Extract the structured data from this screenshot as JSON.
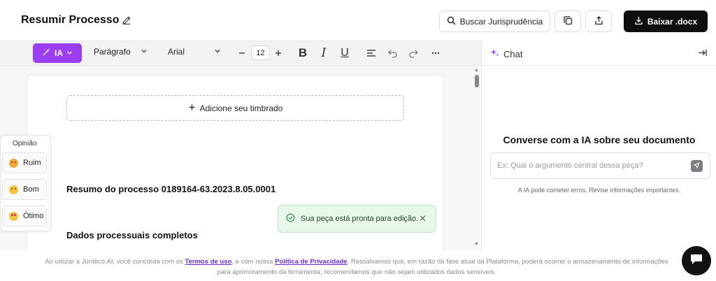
{
  "header": {
    "title": "Resumir Processo",
    "search_label": "Buscar Jurisprudência",
    "download_label": "Baixar .docx"
  },
  "toolbar": {
    "ia_label": "IA",
    "paragraph_style": "Parágrafo",
    "font_family": "Arial",
    "font_size": "12"
  },
  "document": {
    "letterhead_label": "Adicione seu timbrado",
    "heading_1": "Resumo do processo 0189164-63.2023.8.05.0001",
    "heading_2": "Dados processuais completos"
  },
  "feedback": {
    "title": "Opinião",
    "options": [
      {
        "label": "Ruim",
        "icon": "grimace-face-icon"
      },
      {
        "label": "Bom",
        "icon": "smile-face-icon"
      },
      {
        "label": "Ótimo",
        "icon": "heart-eyes-face-icon"
      }
    ]
  },
  "toast": {
    "message": "Sua peça está pronta para edição."
  },
  "chat": {
    "title": "Chat",
    "heading": "Converse com a IA sobre seu documento",
    "input_placeholder": "Ex: Qual o argumento central dessa peça?",
    "disclaimer": "A IA pode cometer erros. Revise informações importantes."
  },
  "footer": {
    "text_1": "Ao utilizar a Jurídico.AI, você concorda com os",
    "terms_link": "Termos de uso",
    "text_2": ", e com nossa",
    "privacy_link": "Política de Privacidade",
    "text_3": ". Ressalvamos que, em razão da fase atual da Plataforma, poderá ocorrer o armazenamento de informações para aprimoramento da ferramenta; recomendamos que não sejam utilizados dados sensíveis."
  },
  "colors": {
    "accent": "#9b3df0",
    "toast_bg": "#e7f7ea",
    "download_bg": "#0e0e0e"
  }
}
